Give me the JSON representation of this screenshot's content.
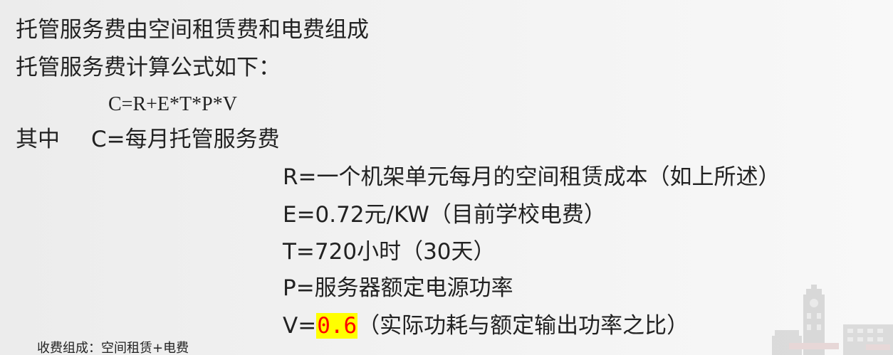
{
  "slide": {
    "intro_line": "托管服务费由空间租赁费和电费组成",
    "formula_intro": "托管服务费计算公式如下：",
    "formula": "C=R+E*T*P*V",
    "where_label": "其中",
    "definitions": {
      "c": "C=每月托管服务费",
      "r": "R=一个机架单元每月的空间租赁成本（如上所述）",
      "e": "E=0.72元/KW（目前学校电费）",
      "t": "T=720小时（30天）",
      "p": "P=服务器额定电源功率",
      "v_prefix": "V=",
      "v_value": "0.6",
      "v_suffix": "（实际功耗与额定输出功率之比）"
    }
  },
  "footer": {
    "caption": "收费组成：空间租赁+电费"
  },
  "decor": {
    "watermark_icon": "campus-building-icon"
  },
  "colors": {
    "text": "#222222",
    "highlight_bg": "#ffff00",
    "highlight_text": "#ff0000",
    "bg_left": "#ececec",
    "bg_mid": "#f3f3f3",
    "bg_right": "#f8f8f8"
  }
}
